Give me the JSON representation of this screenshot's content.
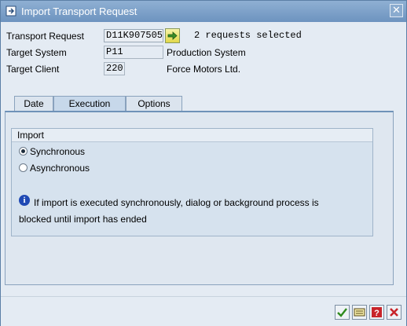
{
  "window": {
    "title": "Import Transport Request",
    "close_glyph": "✕"
  },
  "form": {
    "transport_request": {
      "label": "Transport Request",
      "value": "D11K907505",
      "note": "2 requests selected"
    },
    "target_system": {
      "label": "Target System",
      "value": "P11",
      "description": "Production System"
    },
    "target_client": {
      "label": "Target Client",
      "value": "220",
      "description": "Force Motors Ltd."
    }
  },
  "tabs": [
    {
      "label": "Date",
      "active": false
    },
    {
      "label": "Execution",
      "active": true
    },
    {
      "label": "Options",
      "active": false
    }
  ],
  "import_group": {
    "title": "Import",
    "options": [
      {
        "label": "Synchronous",
        "selected": true
      },
      {
        "label": "Asynchronous",
        "selected": false
      }
    ],
    "info_line1": "If import is executed synchronously, dialog or background process is",
    "info_line2": "blocked until import has ended"
  },
  "footer": {
    "buttons": [
      "confirm-icon",
      "schedule-icon",
      "help-icon",
      "cancel-icon"
    ]
  },
  "colors": {
    "titlebar": "#7a9ec8",
    "accent": "#1f49b4"
  }
}
